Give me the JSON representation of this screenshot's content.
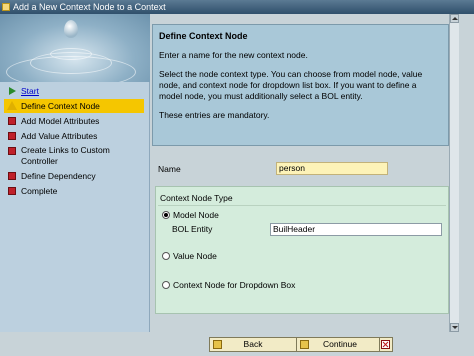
{
  "window": {
    "title": "Add a New Context Node to a Context"
  },
  "steps": [
    {
      "label": "Start",
      "state": "link",
      "icon": "arrow-icon"
    },
    {
      "label": "Define Context Node",
      "state": "active",
      "icon": "warning-triangle-icon"
    },
    {
      "label": "Add Model Attributes",
      "state": "pending",
      "icon": "red-square-icon"
    },
    {
      "label": "Add Value Attributes",
      "state": "pending",
      "icon": "red-square-icon"
    },
    {
      "label": "Create Links to Custom Controller",
      "state": "pending",
      "icon": "red-square-icon"
    },
    {
      "label": "Define Dependency",
      "state": "pending",
      "icon": "red-square-icon"
    },
    {
      "label": "Complete",
      "state": "pending",
      "icon": "red-square-icon"
    }
  ],
  "info": {
    "heading": "Define Context Node",
    "p1": "Enter a name for the new context node.",
    "p2": "Select the node context type. You can choose from model node, value node, and context node for dropdown list box. If you want to define a model node, you must additionally select a BOL entity.",
    "p3": "These entries are mandatory."
  },
  "form": {
    "name_label": "Name",
    "name_value": "person",
    "group_label": "Context Node Type",
    "model_node": "Model Node",
    "bol_label": "BOL Entity",
    "bol_value": "BuilHeader",
    "value_node": "Value Node",
    "dropdown_node": "Context Node for Dropdown Box",
    "selected_type": "model-node"
  },
  "buttons": {
    "back": "Back",
    "continue": "Continue"
  },
  "colors": {
    "active_step": "#f5c600",
    "info_bg": "#a9c8d8",
    "group_bg": "#d4ecdc",
    "name_field_bg": "#fdf3b8"
  }
}
